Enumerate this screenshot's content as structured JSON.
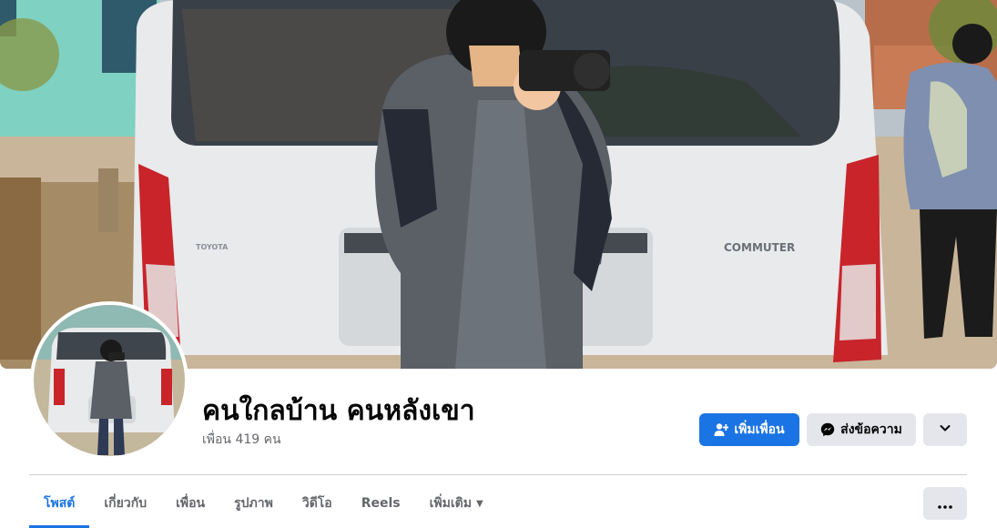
{
  "profile": {
    "name": "คนใกลบ้าน คนหลังเขา",
    "friends_count": "เพื่อน 419 คน"
  },
  "cover": {
    "vehicle_badge": "COMMUTER",
    "vehicle_brand": "TOYOTA"
  },
  "actions": {
    "add_friend": "เพิ่มเพื่อน",
    "message": "ส่งข้อความ"
  },
  "tabs": [
    {
      "label": "โพสต์",
      "active": true
    },
    {
      "label": "เกี่ยวกับ"
    },
    {
      "label": "เพื่อน"
    },
    {
      "label": "รูปภาพ"
    },
    {
      "label": "วิดีโอ"
    },
    {
      "label": "Reels"
    },
    {
      "label": "เพิ่มเติม"
    }
  ],
  "icons": {
    "add_friend": "person-plus-icon",
    "message": "messenger-icon",
    "dropdown": "chevron-down-icon",
    "more_tab": "caret-down-icon",
    "overflow": "ellipsis-icon"
  },
  "colors": {
    "accent": "#1b74e4",
    "secondary_button": "#e4e6eb",
    "text_primary": "#050505",
    "text_secondary": "#65676b"
  }
}
